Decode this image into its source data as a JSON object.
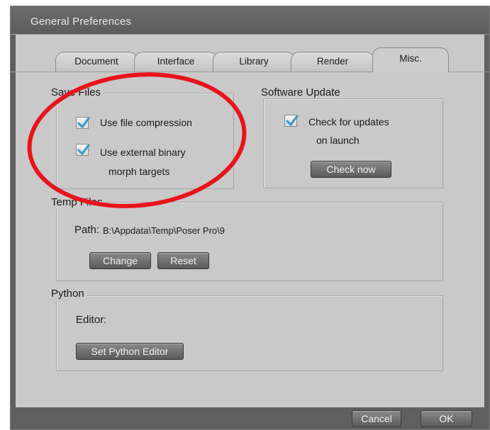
{
  "window": {
    "title": "General Preferences"
  },
  "tabs": [
    {
      "label": "Document",
      "active": false
    },
    {
      "label": "Interface",
      "active": false
    },
    {
      "label": "Library",
      "active": false
    },
    {
      "label": "Render",
      "active": false
    },
    {
      "label": "Misc.",
      "active": true
    }
  ],
  "save_files": {
    "title": "Save Files",
    "compression": {
      "label": "Use file compression",
      "checked": true
    },
    "external_binary": {
      "label_line1": "Use external binary",
      "label_line2": "morph targets",
      "checked": true
    }
  },
  "software_update": {
    "title": "Software Update",
    "check_on_launch": {
      "label_line1": "Check for updates",
      "label_line2": "on launch",
      "checked": true
    },
    "check_now_label": "Check now"
  },
  "temp_files": {
    "title": "Temp Files",
    "path_label": "Path:",
    "path_value": "B:\\Appdata\\Temp\\Poser Pro\\9",
    "change_label": "Change",
    "reset_label": "Reset"
  },
  "python": {
    "title": "Python",
    "editor_label": "Editor:",
    "set_editor_label": "Set Python Editor"
  },
  "footer": {
    "cancel_label": "Cancel",
    "ok_label": "OK"
  },
  "annotation": {
    "color": "#e8141a"
  },
  "colors": {
    "checkmark": "#3aa0c8",
    "dialog_bg": "#c9c9c9",
    "frame": "#5f5f5f"
  }
}
